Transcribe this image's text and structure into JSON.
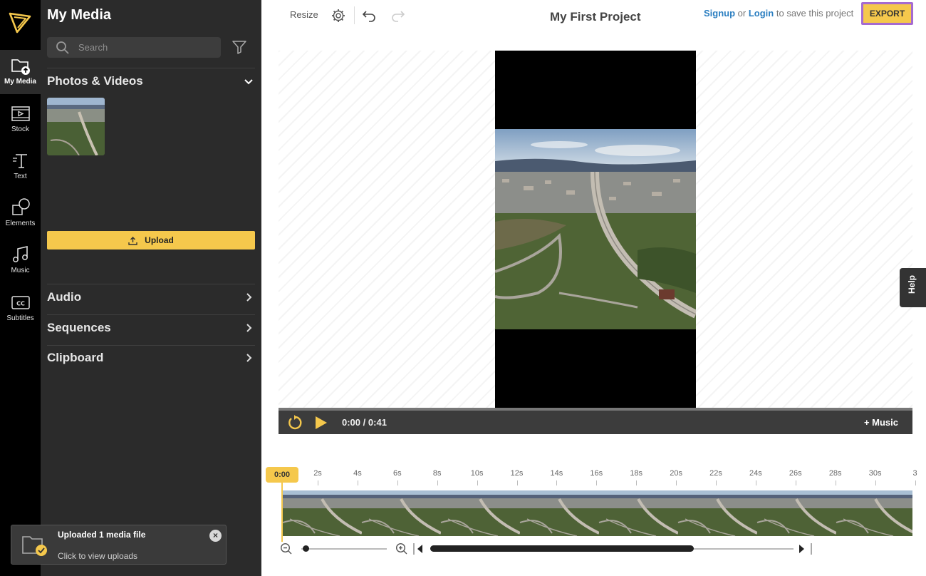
{
  "rail": {
    "items": [
      {
        "label": "My Media",
        "icon": "folder-upload-icon"
      },
      {
        "label": "Stock",
        "icon": "film-icon"
      },
      {
        "label": "Text",
        "icon": "text-icon"
      },
      {
        "label": "Elements",
        "icon": "shapes-icon"
      },
      {
        "label": "Music",
        "icon": "music-note-icon"
      },
      {
        "label": "Subtitles",
        "icon": "closed-captions-icon"
      }
    ]
  },
  "panel": {
    "title": "My Media",
    "search_placeholder": "Search",
    "photos_videos_label": "Photos & Videos",
    "upload_label": "Upload",
    "sections": [
      "Audio",
      "Sequences",
      "Clipboard"
    ]
  },
  "toast": {
    "title": "Uploaded 1 media file",
    "subtitle": "Click to view uploads",
    "close_label": "×"
  },
  "toolbar": {
    "resize_label": "Resize",
    "project_title": "My First Project",
    "signup_label": "Signup",
    "or_text": "or",
    "login_label": "Login",
    "save_suffix": "to save this project",
    "export_label": "EXPORT"
  },
  "player": {
    "current_time": "0:00",
    "separator": "/",
    "duration": "0:41",
    "music_label": "+ Music"
  },
  "help_label": "Help",
  "timeline": {
    "playhead_label": "0:00",
    "ticks": [
      "2s",
      "4s",
      "6s",
      "8s",
      "10s",
      "12s",
      "14s",
      "16s",
      "18s",
      "20s",
      "22s",
      "24s",
      "26s",
      "28s",
      "30s",
      "3"
    ]
  },
  "colors": {
    "accent": "#f5c84c",
    "export_border": "#a56bd0",
    "link": "#2c7fc1"
  }
}
